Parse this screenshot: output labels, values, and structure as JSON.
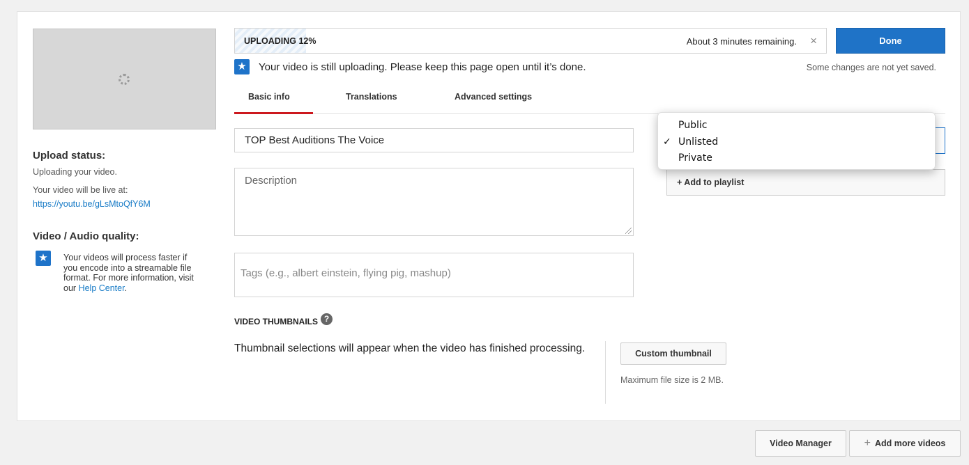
{
  "upload": {
    "progress_label": "UPLOADING 12%",
    "progress_fraction": 0.12,
    "remaining": "About 3 minutes remaining.",
    "close_glyph": "×",
    "done_label": "Done",
    "unsaved_note": "Some changes are not yet saved.",
    "notice": "Your video is still uploading. Please keep this page open until it’s done."
  },
  "sidebar": {
    "status_heading": "Upload status:",
    "status_text": "Uploading your video.",
    "live_text": "Your video will be live at:",
    "live_url": "https://youtu.be/gLsMtoQfY6M",
    "quality_heading": "Video / Audio quality:",
    "quality_text": "Your videos will process faster if you encode into a streamable file format. For more information, visit our",
    "help_link": "Help Center",
    "help_suffix": "."
  },
  "tabs": [
    {
      "label": "Basic info",
      "active": true
    },
    {
      "label": "Translations",
      "active": false
    },
    {
      "label": "Advanced settings",
      "active": false
    }
  ],
  "form": {
    "title_value": "TOP Best Auditions The Voice",
    "description_placeholder": "Description",
    "tags_placeholder": "Tags (e.g., albert einstein, flying pig, mashup)"
  },
  "thumbnails": {
    "heading": "VIDEO THUMBNAILS",
    "help_glyph": "?",
    "message": "Thumbnail selections will appear when the video has finished processing.",
    "custom_label": "Custom thumbnail",
    "max_size": "Maximum file size is 2 MB."
  },
  "privacy": {
    "options": [
      "Public",
      "Unlisted",
      "Private"
    ],
    "selected": "Unlisted",
    "check_glyph": "✓"
  },
  "playlist_label": "+ Add to playlist",
  "footer": {
    "video_manager": "Video Manager",
    "add_more_plus": "+",
    "add_more": "Add more videos"
  },
  "colors": {
    "accent_blue": "#1f73c7",
    "tab_underline": "#cc181e",
    "link": "#167ac6"
  },
  "icons": {
    "notice": "star-icon",
    "quality": "star-icon",
    "help": "question-circle-icon",
    "spinner": "loading-spinner-icon",
    "close": "close-icon",
    "check": "checkmark-icon"
  }
}
